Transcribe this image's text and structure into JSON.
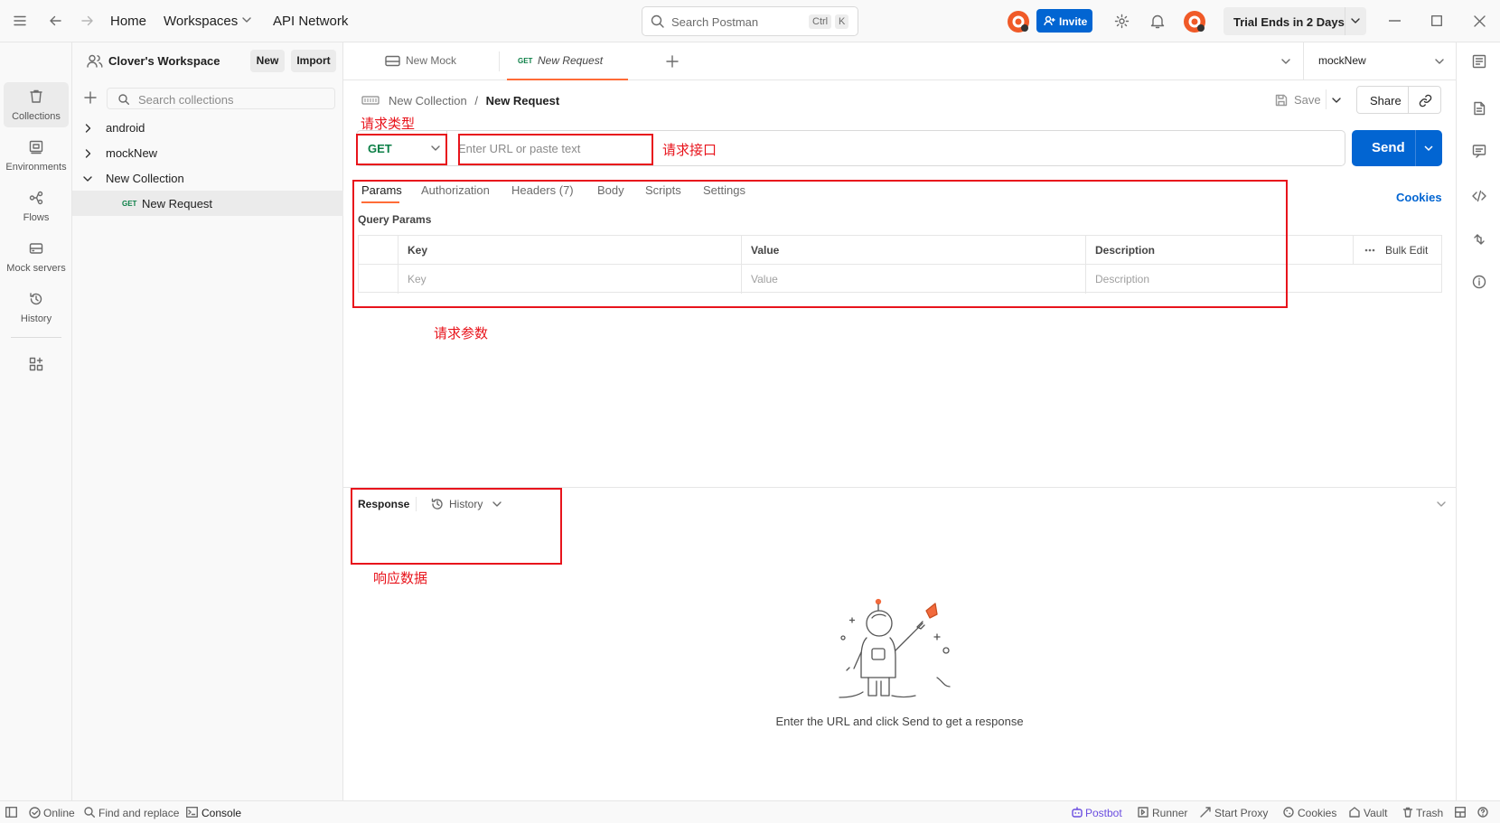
{
  "topbar": {
    "nav": {
      "home": "Home",
      "workspaces": "Workspaces",
      "api_network": "API Network"
    },
    "search": {
      "placeholder": "Search Postman",
      "kbd_ctrl": "Ctrl",
      "kbd_k": "K"
    },
    "invite_label": "Invite",
    "trial_label": "Trial Ends in 2 Days"
  },
  "rail": {
    "items": [
      {
        "label": "Collections",
        "icon": "collections-icon",
        "active": true
      },
      {
        "label": "Environments",
        "icon": "environments-icon"
      },
      {
        "label": "Flows",
        "icon": "flows-icon"
      },
      {
        "label": "Mock servers",
        "icon": "mock-servers-icon"
      },
      {
        "label": "History",
        "icon": "history-icon"
      }
    ]
  },
  "sidebar": {
    "workspace_name": "Clover's Workspace",
    "new_label": "New",
    "import_label": "Import",
    "search_placeholder": "Search collections",
    "tree": [
      {
        "name": "android"
      },
      {
        "name": "mockNew"
      },
      {
        "name": "New Collection"
      },
      {
        "name": "New Request",
        "method": "GET"
      }
    ]
  },
  "tabs": {
    "items": [
      {
        "label": "New Mock"
      },
      {
        "method": "GET",
        "label": "New Request"
      }
    ],
    "environment": "mockNew"
  },
  "request": {
    "breadcrumb_collection": "New Collection",
    "breadcrumb_sep": "/",
    "breadcrumb_request": "New Request",
    "save_label": "Save",
    "share_label": "Share",
    "method": "GET",
    "url_placeholder": "Enter URL or paste text",
    "send_label": "Send",
    "tabs": [
      "Params",
      "Authorization",
      "Headers (7)",
      "Body",
      "Scripts",
      "Settings"
    ],
    "cookies_label": "Cookies",
    "query_params_title": "Query Params",
    "table": {
      "headers": [
        "Key",
        "Value",
        "Description"
      ],
      "bulk_edit": "Bulk Edit",
      "placeholders": [
        "Key",
        "Value",
        "Description"
      ]
    }
  },
  "response": {
    "title": "Response",
    "history_label": "History",
    "empty_message": "Enter the URL and click Send to get a response"
  },
  "statusbar": {
    "online": "Online",
    "find_replace": "Find and replace",
    "console": "Console",
    "postbot": "Postbot",
    "runner": "Runner",
    "start_proxy": "Start Proxy",
    "cookies": "Cookies",
    "vault": "Vault",
    "trash": "Trash"
  },
  "annotations": {
    "request_type": "请求类型",
    "request_url": "请求接口",
    "request_params": "请求参数",
    "response_data": "响应数据"
  },
  "colors": {
    "accent": "#ff6c37",
    "primary": "#0265d2",
    "get_method": "#0b7f46",
    "annotation": "#e8141c"
  }
}
